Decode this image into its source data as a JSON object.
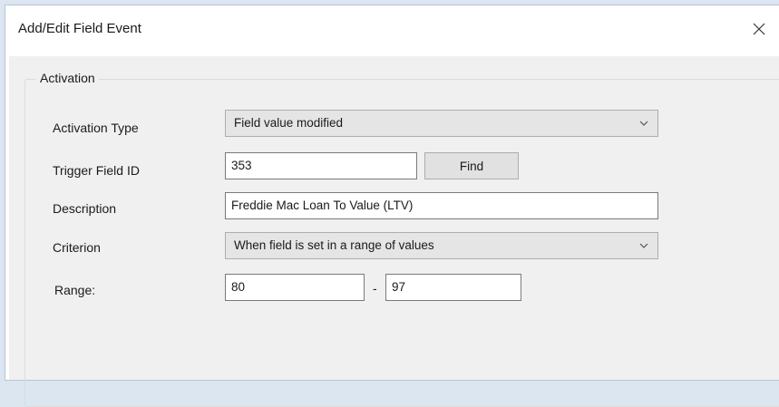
{
  "window": {
    "title": "Add/Edit Field Event"
  },
  "activation": {
    "group_label": "Activation",
    "activation_type": {
      "label": "Activation Type",
      "selected": "Field value modified"
    },
    "trigger_field_id": {
      "label": "Trigger Field ID",
      "value": "353",
      "find_label": "Find"
    },
    "description": {
      "label": "Description",
      "value": "Freddie Mac Loan To Value (LTV)"
    },
    "criterion": {
      "label": "Criterion",
      "selected": "When field is set in a range of values"
    },
    "range": {
      "label": "Range:",
      "from": "80",
      "separator": "-",
      "to": "97"
    }
  },
  "icons": {
    "close": "close-icon",
    "dropdown": "chevron-down-icon"
  }
}
